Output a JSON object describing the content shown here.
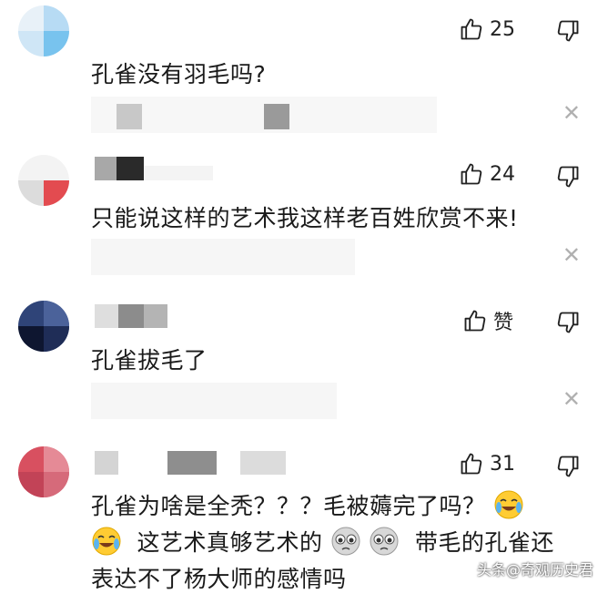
{
  "comments": [
    {
      "text": "孔雀没有羽毛吗?",
      "likes": "25",
      "avatar_colors": [
        "#e6f0f8",
        "#a9d3f2",
        "#70c0ee"
      ]
    },
    {
      "text": "只能说这样的艺术我这样老百姓欣赏不来!",
      "likes": "24",
      "avatar_colors": [
        "#f2f2f2",
        "#e34b50",
        "#d8d8d8"
      ]
    },
    {
      "text": "孔雀拔毛了",
      "likes": "赞",
      "avatar_colors": [
        "#2a3c6e",
        "#10193a",
        "#4a5f96"
      ]
    },
    {
      "text_line1": "孔雀为啥是全秃？？？毛被薅完了吗？",
      "text_line2": "这艺术真够艺术的",
      "text_line2b": "带毛的孔雀还",
      "text_line3": "表达不了杨大师的感情吗",
      "likes": "31",
      "avatar_colors": [
        "#d85060",
        "#e87f8e",
        "#b8485a"
      ]
    }
  ],
  "icons": {
    "like": "thumbs-up-icon",
    "dislike": "thumbs-down-icon",
    "close": "close-icon",
    "emoji_cry": "crying-laughing-emoji",
    "emoji_pleading": "pleading-face-emoji"
  },
  "watermark": "头条@奇观历史君",
  "close_glyph": "✕"
}
